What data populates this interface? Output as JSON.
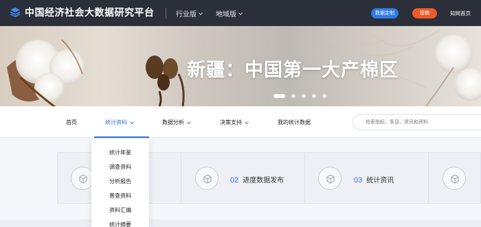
{
  "header": {
    "site_title": "中国经济社会大数据研究平台",
    "nav": [
      "行业版",
      "地域版"
    ],
    "data_custom_label": "数据定制",
    "submit_label": "投稿",
    "home_label": "知网首页"
  },
  "banner": {
    "title": "新疆：中国第一大产棉区",
    "slide_count": 5,
    "active_slide": 1
  },
  "subnav": {
    "items": [
      "首页",
      "统计资料",
      "数据分析",
      "决策支持",
      "我的统计数据"
    ],
    "active": "统计资料",
    "search_placeholder": "检索指标、条目、资讯和资料"
  },
  "dropdown": {
    "items": [
      "统计年鉴",
      "调查资料",
      "分析报告",
      "普查资料",
      "资料汇编",
      "统计摘要"
    ]
  },
  "cards": [
    {
      "num": "02",
      "label": "进度数据发布"
    },
    {
      "num": "03",
      "label": "统计资讯"
    }
  ],
  "colors": {
    "topbar": "#2b2f3a",
    "accent_blue": "#2f6fd8",
    "pill_blue": "#2f7be6",
    "pill_orange": "#ef5a2a"
  }
}
